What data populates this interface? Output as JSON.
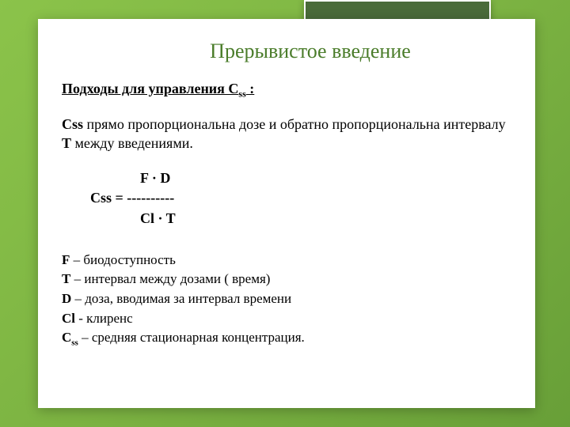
{
  "title": "Прерывистое введение",
  "heading": {
    "prefix": "Подходы для управления C",
    "sub": "ss",
    "suffix": " :"
  },
  "paragraph": {
    "p1a": "Css",
    "p1b": "  прямо пропорциональна дозе и обратно пропорциональна интервалу ",
    "p1c": "Т",
    "p1d": " между введениями."
  },
  "formula": {
    "line1": "                      F · D",
    "line2": "        Css = ----------",
    "line3": "                      Cl · T"
  },
  "defs": {
    "f_sym": "F",
    "f_txt": " – биодоступность",
    "t_sym": "T",
    "t_txt": " – интервал между дозами ( время)",
    "d_sym": "D",
    "d_txt": " – доза, вводимая за интервал времени",
    "cl_sym": "Cl",
    "cl_txt": " - клиренс",
    "c_sym": "C",
    "c_sub": "ss",
    "c_txt": "  – средняя стационарная концентрация."
  }
}
